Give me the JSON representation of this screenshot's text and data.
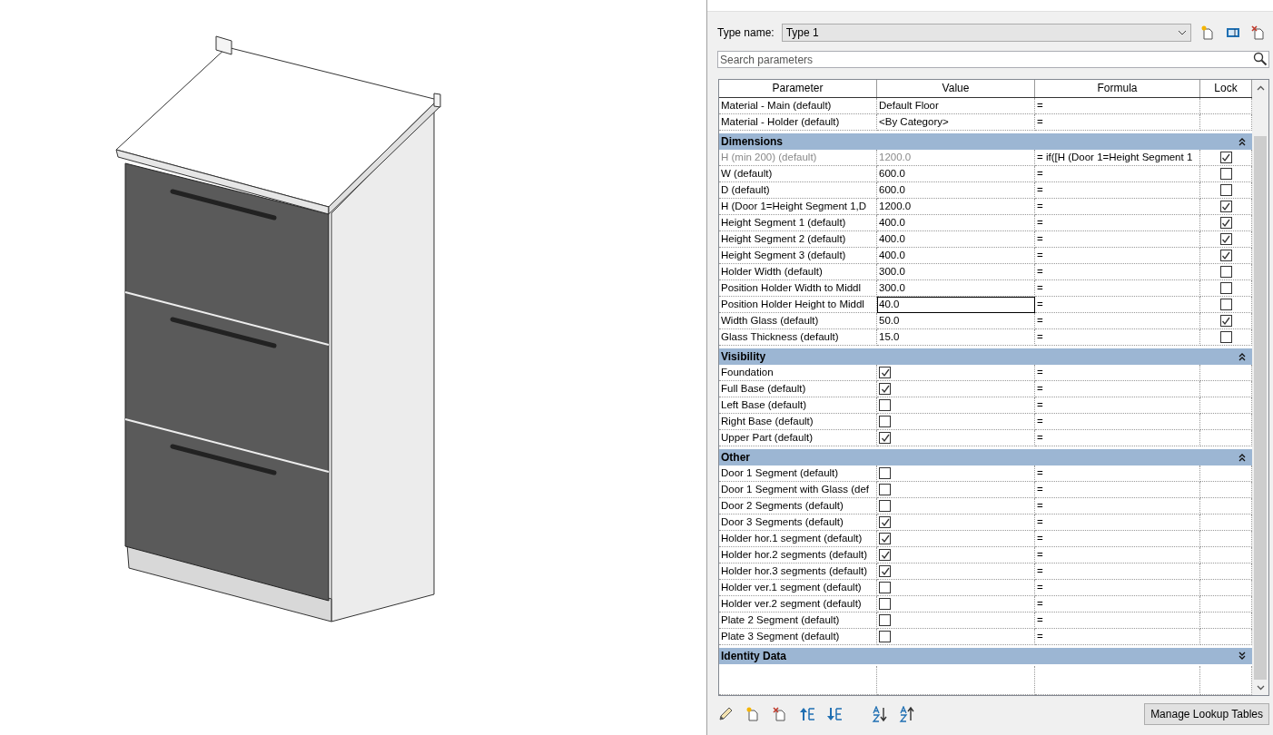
{
  "type_name": {
    "label": "Type name:",
    "value": "Type 1"
  },
  "search": {
    "placeholder": "Search parameters"
  },
  "columns": [
    "Parameter",
    "Value",
    "Formula",
    "Lock"
  ],
  "top_rows": [
    {
      "parameter": "Material - Main (default)",
      "kind": "text",
      "value": "Default Floor",
      "formula": "="
    },
    {
      "parameter": "Material - Holder (default)",
      "kind": "text",
      "value": "<By Category>",
      "formula": "="
    }
  ],
  "groups": [
    {
      "title": "Dimensions",
      "expanded": true,
      "rows": [
        {
          "parameter": "H (min 200) (default)",
          "kind": "text",
          "value": "1200.0",
          "formula": "= if([H (Door 1=Height Segment 1",
          "locked": true,
          "disabled": true,
          "editing": false
        },
        {
          "parameter": "W (default)",
          "kind": "text",
          "value": "600.0",
          "formula": "=",
          "locked": false,
          "disabled": false,
          "editing": false
        },
        {
          "parameter": "D (default)",
          "kind": "text",
          "value": "600.0",
          "formula": "=",
          "locked": false,
          "disabled": false,
          "editing": false
        },
        {
          "parameter": "H (Door 1=Height Segment 1,D",
          "kind": "text",
          "value": "1200.0",
          "formula": "=",
          "locked": true,
          "disabled": false,
          "editing": false
        },
        {
          "parameter": "Height Segment 1 (default)",
          "kind": "text",
          "value": "400.0",
          "formula": "=",
          "locked": true,
          "disabled": false,
          "editing": false
        },
        {
          "parameter": "Height Segment 2 (default)",
          "kind": "text",
          "value": "400.0",
          "formula": "=",
          "locked": true,
          "disabled": false,
          "editing": false
        },
        {
          "parameter": "Height Segment 3 (default)",
          "kind": "text",
          "value": "400.0",
          "formula": "=",
          "locked": true,
          "disabled": false,
          "editing": false
        },
        {
          "parameter": "Holder Width (default)",
          "kind": "text",
          "value": "300.0",
          "formula": "=",
          "locked": false,
          "disabled": false,
          "editing": false
        },
        {
          "parameter": "Position Holder Width to Middl",
          "kind": "text",
          "value": "300.0",
          "formula": "=",
          "locked": false,
          "disabled": false,
          "editing": false
        },
        {
          "parameter": "Position Holder Height to Middl",
          "kind": "text",
          "value": "40.0",
          "formula": "=",
          "locked": false,
          "disabled": false,
          "editing": true
        },
        {
          "parameter": "Width Glass (default)",
          "kind": "text",
          "value": "50.0",
          "formula": "=",
          "locked": true,
          "disabled": false,
          "editing": false
        },
        {
          "parameter": "Glass Thickness (default)",
          "kind": "text",
          "value": "15.0",
          "formula": "=",
          "locked": false,
          "disabled": false,
          "editing": false
        }
      ]
    },
    {
      "title": "Visibility",
      "expanded": true,
      "rows": [
        {
          "parameter": "Foundation",
          "kind": "check",
          "checked": true,
          "formula": "="
        },
        {
          "parameter": "Full Base (default)",
          "kind": "check",
          "checked": true,
          "formula": "="
        },
        {
          "parameter": "Left Base (default)",
          "kind": "check",
          "checked": false,
          "formula": "="
        },
        {
          "parameter": "Right Base (default)",
          "kind": "check",
          "checked": false,
          "formula": "="
        },
        {
          "parameter": "Upper Part (default)",
          "kind": "check",
          "checked": true,
          "formula": "="
        }
      ]
    },
    {
      "title": "Other",
      "expanded": true,
      "rows": [
        {
          "parameter": "Door 1 Segment (default)",
          "kind": "check",
          "checked": false,
          "formula": "="
        },
        {
          "parameter": "Door 1 Segment with Glass (def",
          "kind": "check",
          "checked": false,
          "formula": "="
        },
        {
          "parameter": "Door 2 Segments (default)",
          "kind": "check",
          "checked": false,
          "formula": "="
        },
        {
          "parameter": "Door 3 Segments (default)",
          "kind": "check",
          "checked": true,
          "formula": "="
        },
        {
          "parameter": "Holder hor.1 segment (default)",
          "kind": "check",
          "checked": true,
          "formula": "="
        },
        {
          "parameter": "Holder hor.2 segments (default)",
          "kind": "check",
          "checked": true,
          "formula": "="
        },
        {
          "parameter": "Holder hor.3 segments (default)",
          "kind": "check",
          "checked": true,
          "formula": "="
        },
        {
          "parameter": "Holder ver.1 segment (default)",
          "kind": "check",
          "checked": false,
          "formula": "="
        },
        {
          "parameter": "Holder ver.2 segment (default)",
          "kind": "check",
          "checked": false,
          "formula": "="
        },
        {
          "parameter": "Plate 2 Segment (default)",
          "kind": "check",
          "checked": false,
          "formula": "="
        },
        {
          "parameter": "Plate 3 Segment (default)",
          "kind": "check",
          "checked": false,
          "formula": "="
        }
      ]
    },
    {
      "title": "Identity Data",
      "expanded": false
    }
  ],
  "footer_button": "Manage Lookup Tables"
}
